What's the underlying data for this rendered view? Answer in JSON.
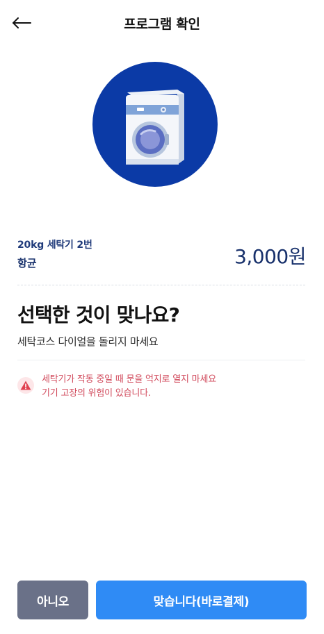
{
  "header": {
    "title": "프로그램 확인"
  },
  "icons": {
    "back": "arrow-left-icon",
    "hero": "washing-machine-illustration",
    "warning": "warning-triangle-icon"
  },
  "machine": {
    "name": "20kg 세탁기 2번",
    "course": "항균",
    "price": "3,000원"
  },
  "confirm": {
    "question": "선택한 것이 맞나요?",
    "instruction": "세탁코스 다이얼을 돌리지 마세요"
  },
  "warning": {
    "line1": "세탁기가 작동 중일 때 문을 억지로 열지 마세요",
    "line2": "기기 고장의 위험이 있습니다."
  },
  "buttons": {
    "no_label": "아니오",
    "yes_label": "맞습니다(바로결제)"
  },
  "colors": {
    "navy": "#17306b",
    "hero_circle": "#0b3aa6",
    "warning": "#d1495b",
    "secondary_button": "#6a7188",
    "primary_button": "#2f8bf5"
  }
}
